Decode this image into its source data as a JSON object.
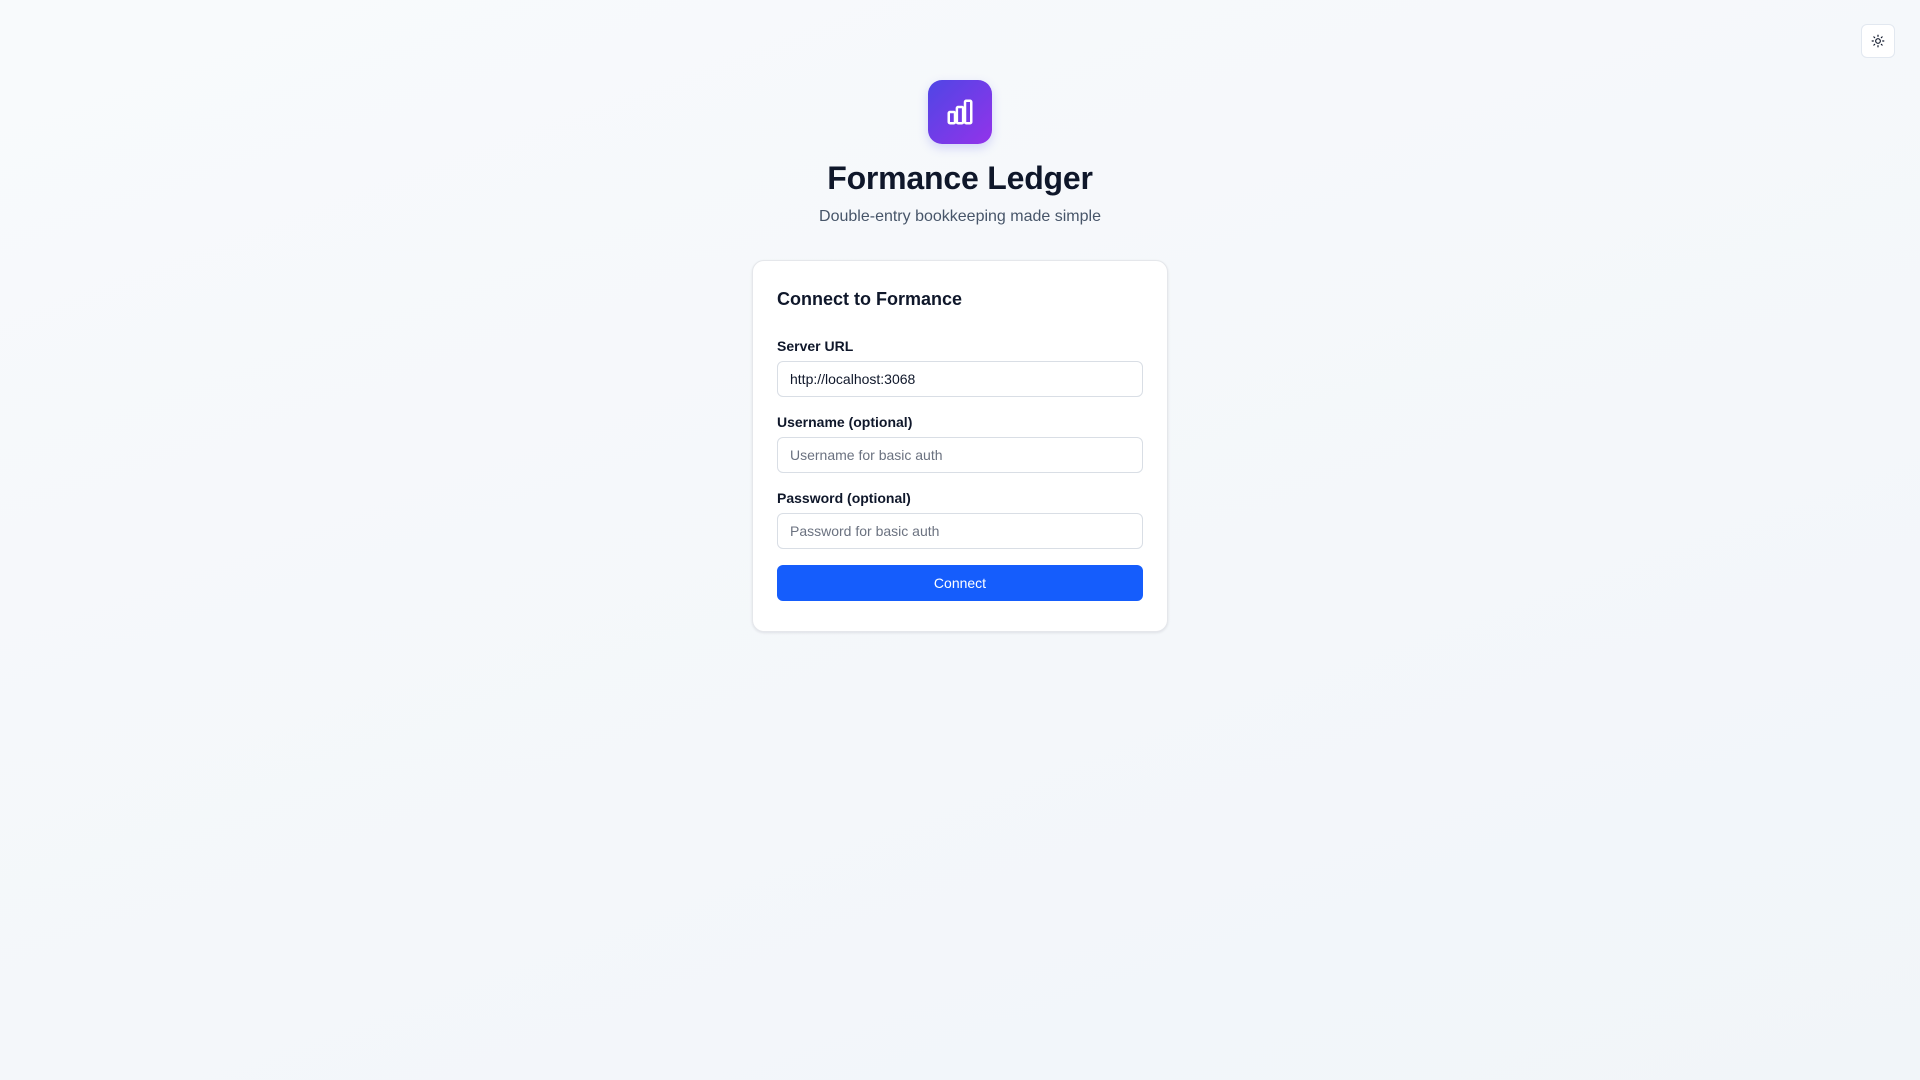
{
  "theme_toggle": {
    "icon": "sun-icon"
  },
  "brand": {
    "logo_icon": "bar-chart-icon",
    "logo_gradient": [
      "#4f46e5",
      "#9333ea"
    ],
    "title": "Formance Ledger",
    "subtitle": "Double-entry bookkeeping made simple"
  },
  "form": {
    "title": "Connect to Formance",
    "server_url": {
      "label": "Server URL",
      "value": "http://localhost:3068"
    },
    "username": {
      "label": "Username (optional)",
      "placeholder": "Username for basic auth"
    },
    "password": {
      "label": "Password (optional)",
      "placeholder": "Password for basic auth"
    },
    "submit_label": "Connect",
    "accent_color": "#155dfc"
  }
}
